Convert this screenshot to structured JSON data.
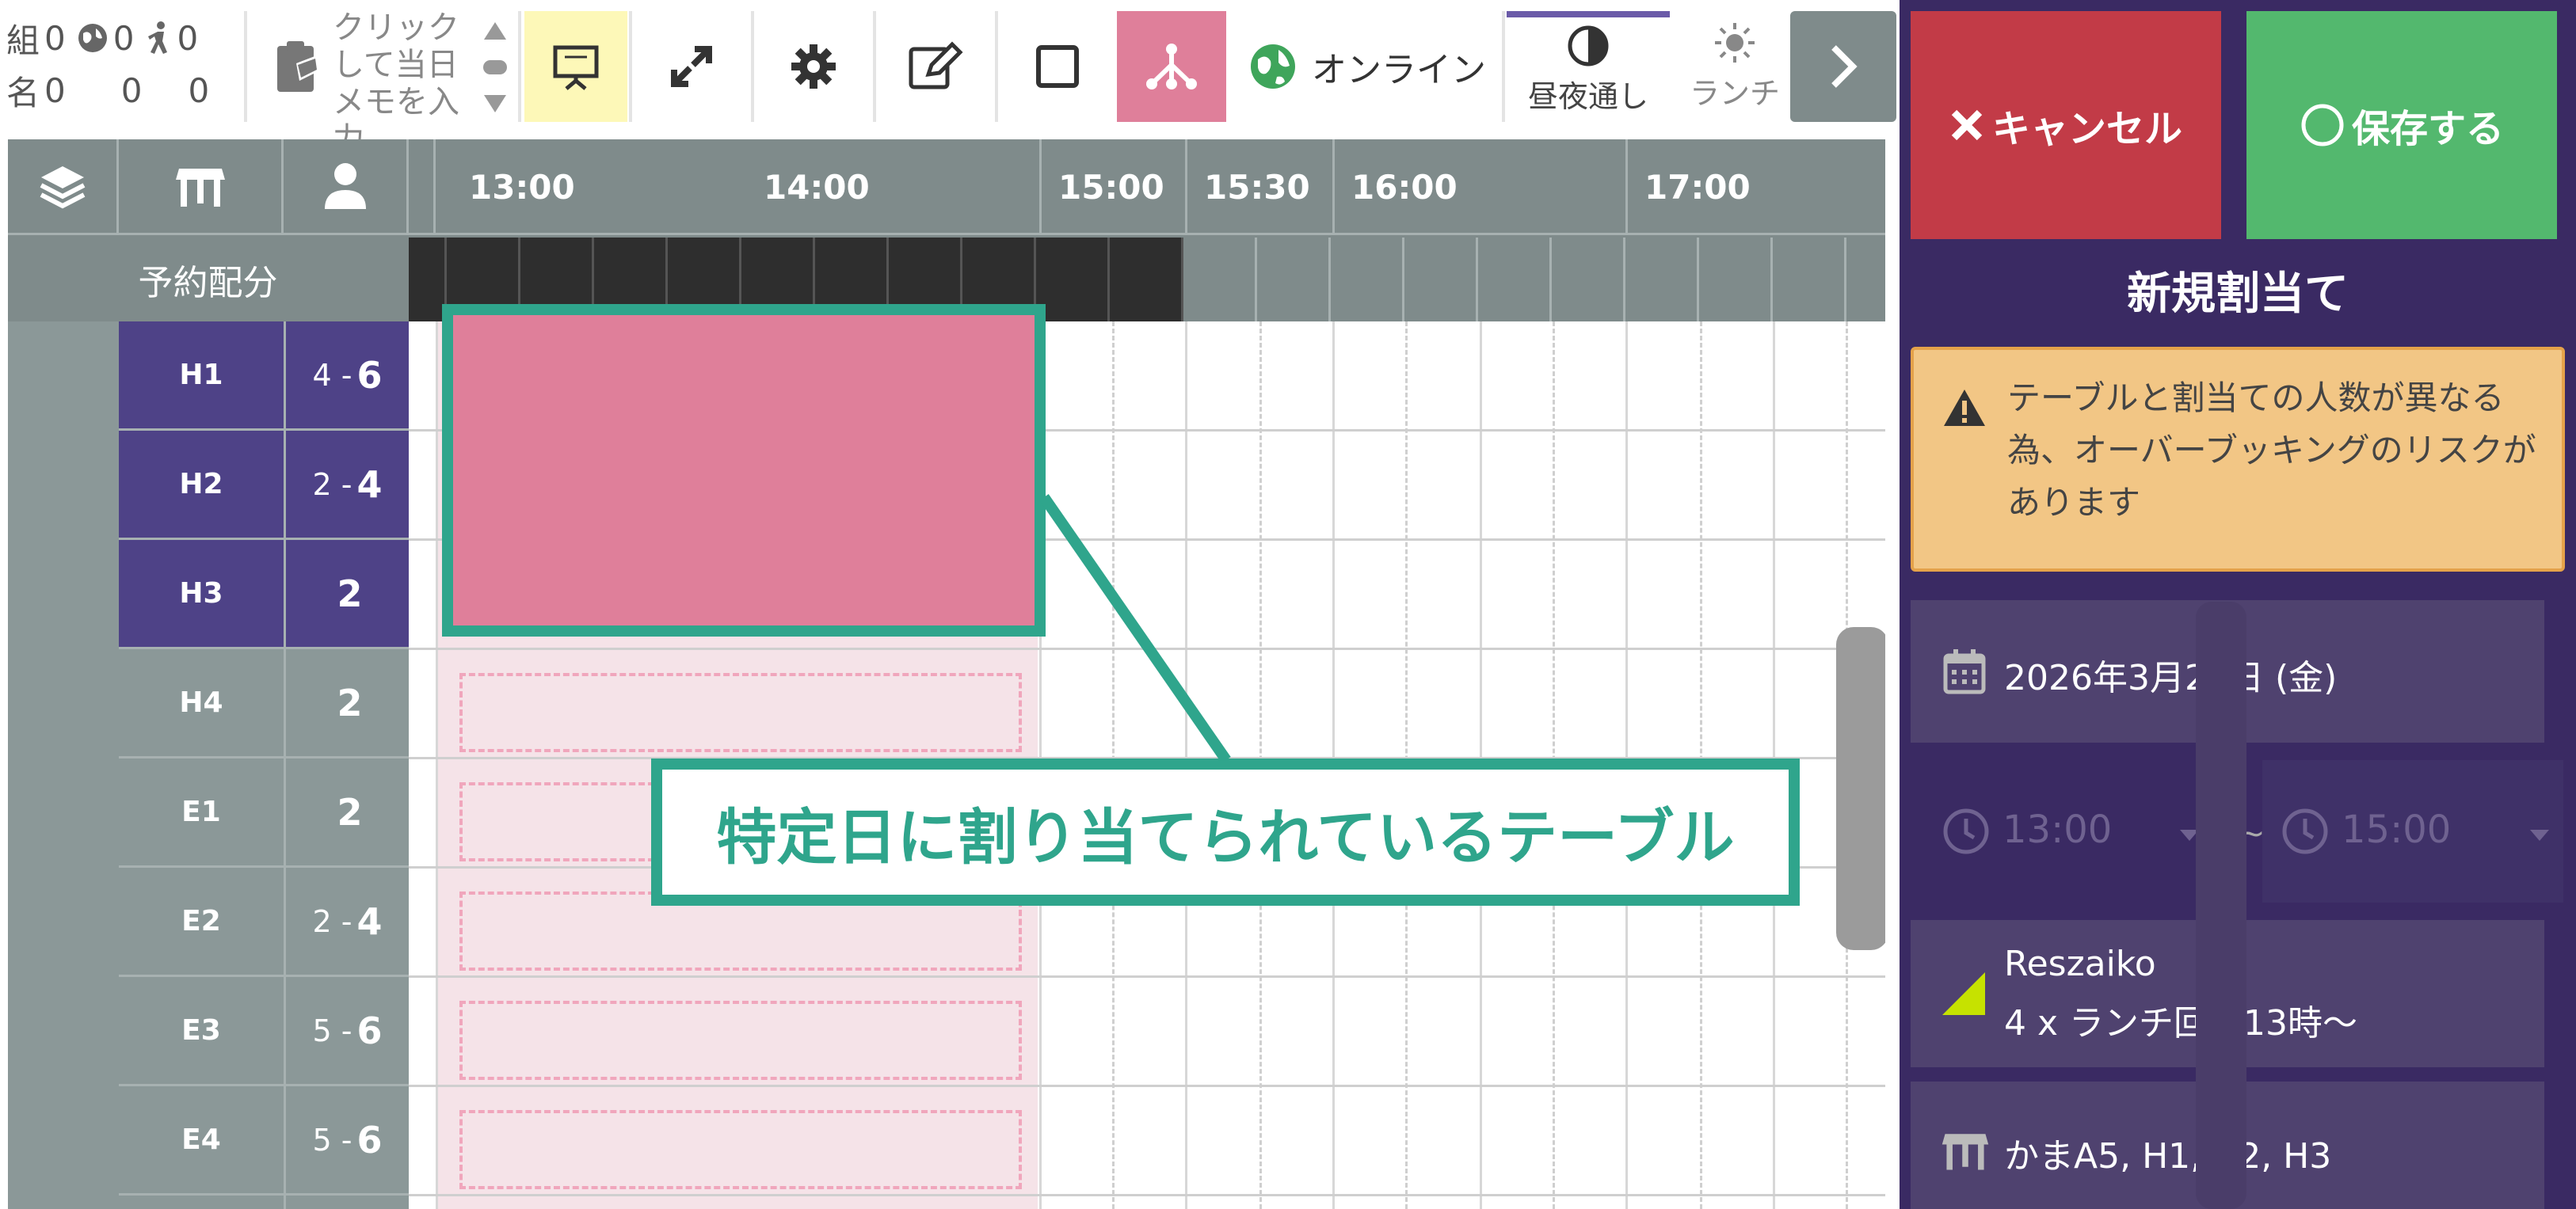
{
  "toolbar": {
    "counts": {
      "groups_label": "組",
      "groups_value": "0",
      "web_value": "0",
      "walk_value": "0",
      "people_label": "名",
      "people_value": "0",
      "web_people": "0",
      "walk_people": "0"
    },
    "memo_hint": "クリックして当日メモを入力",
    "online_label": "オンライン",
    "day_night_label": "昼夜通し",
    "lunch_label": "ランチ",
    "icons": [
      "layers-icon",
      "table-icon",
      "person-icon",
      "presentation-icon",
      "expand-icon",
      "gear-icon",
      "pencil-icon",
      "square-icon",
      "network-icon",
      "globe-icon",
      "half-circle-icon",
      "sun-icon",
      "chevron-right-icon"
    ],
    "highlight_colors": {
      "yellow": "#fdf8b8",
      "pink": "#df7f9a",
      "accent": "#6a5aa8"
    }
  },
  "grid": {
    "times": [
      "13:00",
      "14:00",
      "15:00",
      "15:30",
      "16:00",
      "17:00"
    ],
    "reservation_row_label": "予約配分",
    "rows": [
      {
        "name": "H1",
        "range": "4 -",
        "cap": "6",
        "style": "purple"
      },
      {
        "name": "H2",
        "range": "2 -",
        "cap": "4",
        "style": "purple"
      },
      {
        "name": "H3",
        "range": "",
        "cap": "2",
        "style": "purple"
      },
      {
        "name": "H4",
        "range": "",
        "cap": "2",
        "style": "gray"
      },
      {
        "name": "E1",
        "range": "",
        "cap": "2",
        "style": "gray"
      },
      {
        "name": "E2",
        "range": "2 -",
        "cap": "4",
        "style": "gray"
      },
      {
        "name": "E3",
        "range": "5 -",
        "cap": "6",
        "style": "gray"
      },
      {
        "name": "E4",
        "range": "5 -",
        "cap": "6",
        "style": "gray"
      }
    ]
  },
  "callout": {
    "text": "特定日に割り当てられているテーブル"
  },
  "panel": {
    "cancel_label": "キャンセル",
    "save_label": "保存する",
    "title": "新規割当て",
    "warning": "テーブルと割当ての人数が異なる為、オーバーブッキングのリスクがあります",
    "date": "2026年3月27日 (金)",
    "time_start": "13:00",
    "time_sep": "~",
    "time_end": "15:00",
    "source_name": "Reszaiko",
    "source_detail": "4 x ランチ回転13時〜",
    "tables": "かまA5, H1, H2, H3",
    "colors": {
      "cancel": "#c23b47",
      "save": "#53b86e",
      "panel_bg": "#3a2a63",
      "warning_bg": "#f2c685",
      "source_marker": "#c6e200"
    }
  }
}
